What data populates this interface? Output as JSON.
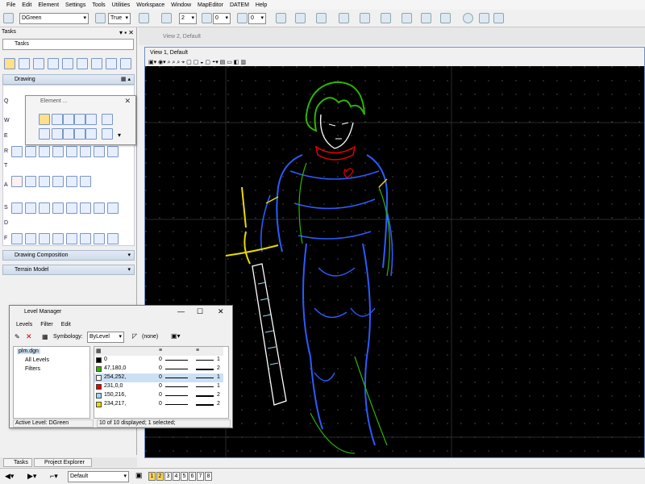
{
  "menu": [
    "File",
    "Edit",
    "Element",
    "Settings",
    "Tools",
    "Utilities",
    "Workspace",
    "Window",
    "MapEditor",
    "DATEM",
    "Help"
  ],
  "toolbar": {
    "level_combo": "DGreen",
    "true_combo": "True",
    "num_a": "2",
    "num_b": "0",
    "num_c": "0"
  },
  "tasks": {
    "panel_title": "Tasks",
    "combo": "Tasks",
    "drawing_label": "Drawing",
    "row_labels": [
      "Q",
      "W",
      "E",
      "R",
      "T",
      "A",
      "S",
      "D",
      "F"
    ],
    "drawing_composition": "Drawing Composition",
    "terrain_model": "Terrain Model"
  },
  "element_dialog": {
    "title": "Element ..."
  },
  "views": {
    "view2": "View 2, Default",
    "view1": "View 1, Default"
  },
  "level_manager": {
    "title": "Level Manager",
    "menu": [
      "Levels",
      "Filter",
      "Edit"
    ],
    "symbology_label": "Symbology:",
    "symbology_value": "ByLevel",
    "none_value": "(none)",
    "tree": [
      "plm.dgn",
      "All Levels",
      "Filters"
    ],
    "rows": [
      {
        "color": "#000000",
        "name": "0",
        "weight": "0",
        "style": "1"
      },
      {
        "color": "#2fb400",
        "name": "47,180,0",
        "weight": "0",
        "style": "2"
      },
      {
        "color": "#fefcfd",
        "name": "254,252,",
        "weight": "0",
        "style": "1"
      },
      {
        "color": "#e70000",
        "name": "231,0,0",
        "weight": "0",
        "style": "1"
      },
      {
        "color": "#96d8f0",
        "name": "150,216,",
        "weight": "0",
        "style": "2"
      },
      {
        "color": "#eadb00",
        "name": "234,217,",
        "weight": "0",
        "style": "2"
      }
    ],
    "status_left": "Active Level: DGreen",
    "status_right": "10 of 10 displayed; 1 selected;"
  },
  "bottom": {
    "tab_tasks": "Tasks",
    "tab_project": "Project Explorer",
    "default_combo": "Default",
    "view_buttons": [
      "1",
      "2",
      "3",
      "4",
      "5",
      "6",
      "7",
      "8"
    ]
  },
  "colors": {
    "canvas": "#000000",
    "green": "#2fb400",
    "blue": "#2a5cff",
    "yellow": "#eadb00",
    "red": "#e70000",
    "white": "#ffffff"
  }
}
